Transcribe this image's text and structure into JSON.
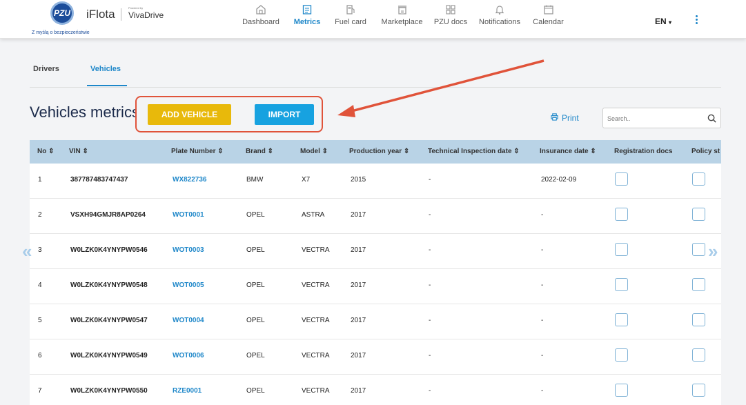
{
  "header": {
    "logo_text": "PZU",
    "tagline": "Z myślą o bezpieczeństwie",
    "app_name": "iFlota",
    "powered_by": "Powered by",
    "partner": "VivaDrive",
    "nav": [
      {
        "label": "Dashboard",
        "icon": "home-icon"
      },
      {
        "label": "Metrics",
        "icon": "document-icon"
      },
      {
        "label": "Fuel card",
        "icon": "fuel-icon"
      },
      {
        "label": "Marketplace",
        "icon": "store-icon"
      },
      {
        "label": "PZU docs",
        "icon": "grid-icon"
      },
      {
        "label": "Notifications",
        "icon": "bell-icon"
      },
      {
        "label": "Calendar",
        "icon": "calendar-icon"
      }
    ],
    "language": "EN",
    "active_nav": "Metrics"
  },
  "tabs": [
    "Drivers",
    "Vehicles"
  ],
  "active_tab": "Vehicles",
  "page_title": "Vehicles metrics",
  "buttons": {
    "add_vehicle": "ADD VEHICLE",
    "import": "IMPORT",
    "print": "Print"
  },
  "search": {
    "placeholder": "Search..",
    "value": ""
  },
  "table": {
    "columns": [
      "No ⇕",
      "VIN ⇕",
      "Plate Number ⇕",
      "Brand ⇕",
      "Model ⇕",
      "Production year ⇕",
      "Technical Inspection date ⇕",
      "Insurance date ⇕",
      "Registration docs",
      "Policy st"
    ],
    "rows": [
      {
        "no": "1",
        "vin": "387787483747437",
        "plate": "WX822736",
        "brand": "BMW",
        "model": "X7",
        "year": "2015",
        "inspection": "-",
        "insurance": "2022-02-09"
      },
      {
        "no": "2",
        "vin": "VSXH94GMJR8AP0264",
        "plate": "WOT0001",
        "brand": "OPEL",
        "model": "ASTRA",
        "year": "2017",
        "inspection": "-",
        "insurance": "-"
      },
      {
        "no": "3",
        "vin": "W0LZK0K4YNYPW0546",
        "plate": "WOT0003",
        "brand": "OPEL",
        "model": "VECTRA",
        "year": "2017",
        "inspection": "-",
        "insurance": "-"
      },
      {
        "no": "4",
        "vin": "W0LZK0K4YNYPW0548",
        "plate": "WOT0005",
        "brand": "OPEL",
        "model": "VECTRA",
        "year": "2017",
        "inspection": "-",
        "insurance": "-"
      },
      {
        "no": "5",
        "vin": "W0LZK0K4YNYPW0547",
        "plate": "WOT0004",
        "brand": "OPEL",
        "model": "VECTRA",
        "year": "2017",
        "inspection": "-",
        "insurance": "-"
      },
      {
        "no": "6",
        "vin": "W0LZK0K4YNYPW0549",
        "plate": "WOT0006",
        "brand": "OPEL",
        "model": "VECTRA",
        "year": "2017",
        "inspection": "-",
        "insurance": "-"
      },
      {
        "no": "7",
        "vin": "W0LZK0K4YNYPW0550",
        "plate": "RZE0001",
        "brand": "OPEL",
        "model": "VECTRA",
        "year": "2017",
        "inspection": "-",
        "insurance": "-"
      }
    ]
  },
  "pager": {
    "prev": "«",
    "next": "»"
  },
  "colors": {
    "accent": "#1e87c9",
    "add_button": "#e8b90b",
    "import_button": "#17a2e0",
    "annotation": "#e0533a",
    "table_header": "#b9d3e6",
    "brand_blue": "#1c4d9a"
  }
}
